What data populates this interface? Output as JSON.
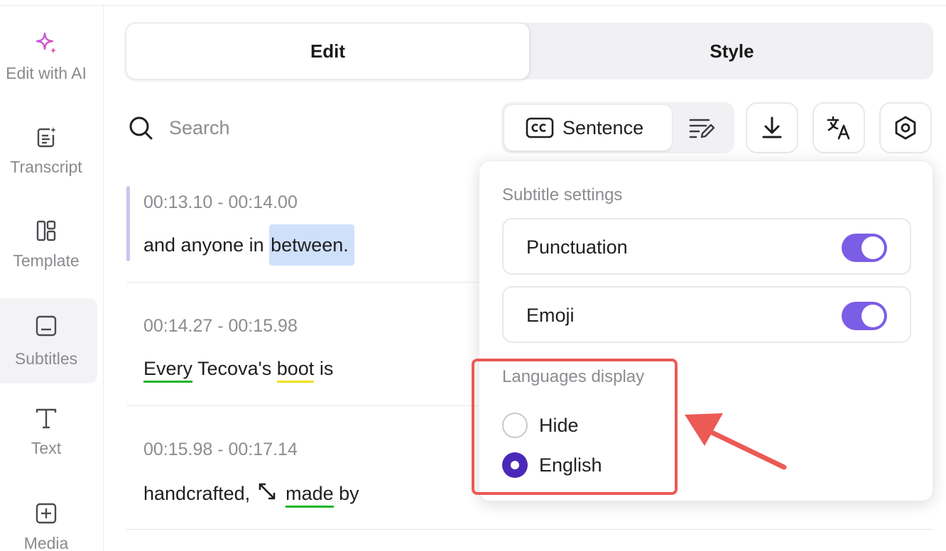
{
  "sidebar": {
    "items": [
      {
        "label": "Edit with AI",
        "icon": "sparkle-icon",
        "active": false
      },
      {
        "label": "Transcript",
        "icon": "transcript-icon",
        "active": false
      },
      {
        "label": "Template",
        "icon": "template-icon",
        "active": false
      },
      {
        "label": "Subtitles",
        "icon": "subtitles-icon",
        "active": true
      },
      {
        "label": "Text",
        "icon": "text-icon",
        "active": false
      },
      {
        "label": "Media",
        "icon": "media-icon",
        "active": false
      }
    ]
  },
  "tabs": [
    {
      "label": "Edit",
      "selected": true
    },
    {
      "label": "Style",
      "selected": false
    }
  ],
  "search": {
    "placeholder": "Search",
    "value": ""
  },
  "toolbar": {
    "mode_label": "Sentence",
    "mode_icon": "closed-captions-icon",
    "icons": [
      "edit-text-icon",
      "download-icon",
      "translate-icon",
      "settings-icon"
    ]
  },
  "subtitles": [
    {
      "time": "00:13.10 - 00:14.00",
      "text_before": "and anyone in ",
      "highlight": "between."
    },
    {
      "time": "00:14.27 - 00:15.98",
      "w1": "Every",
      "w2": " Tecova's ",
      "w3": "boot",
      "w4": " is"
    },
    {
      "time": "00:15.98 - 00:17.14",
      "w1": "handcrafted,",
      "w2": "made",
      "w3": " by"
    }
  ],
  "settings": {
    "title": "Subtitle settings",
    "options": [
      {
        "label": "Punctuation",
        "enabled": true
      },
      {
        "label": "Emoji",
        "enabled": true
      }
    ],
    "languages_title": "Languages display",
    "languages": [
      {
        "label": "Hide",
        "selected": false
      },
      {
        "label": "English",
        "selected": true
      }
    ]
  },
  "colors": {
    "accent": "#7b5de6",
    "radio_selected": "#4b29b8",
    "annotation": "#ec5a55",
    "highlight": "#cfe0fb",
    "underline_green": "#1db52a",
    "underline_yellow": "#f2e01a"
  }
}
